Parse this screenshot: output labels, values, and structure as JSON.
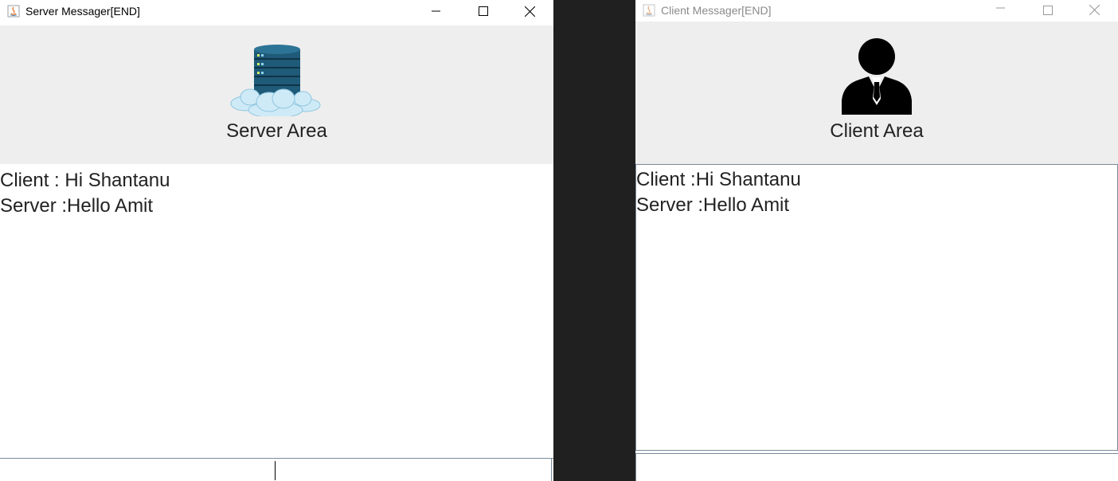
{
  "server_window": {
    "title": "Server Messager[END]",
    "header_label": "Server Area",
    "header_icon": "server-cloud-icon",
    "messages": [
      "Client : Hi Shantanu",
      "Server :Hello Amit"
    ],
    "input_value": ""
  },
  "client_window": {
    "title": "Client Messager[END]",
    "header_label": "Client Area",
    "header_icon": "user-icon",
    "messages": [
      "Client :Hi Shantanu",
      "Server :Hello Amit"
    ],
    "input_value": ""
  },
  "colors": {
    "header_background": "#eeeeee",
    "server_db_blue": "#1f5a78",
    "cloud_blue": "#bfe3f3",
    "desktop_background": "#202020"
  }
}
